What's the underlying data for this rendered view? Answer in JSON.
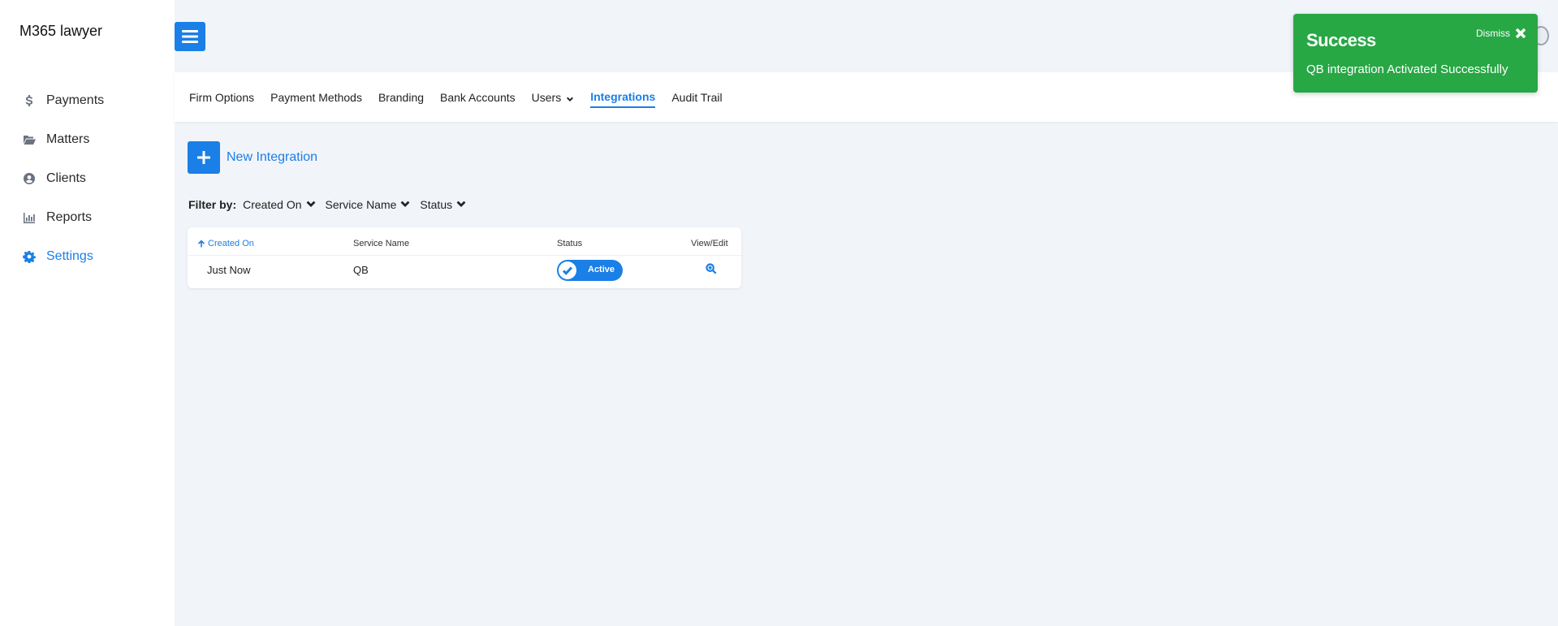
{
  "app": {
    "brand": "M365 lawyer"
  },
  "sidebar": {
    "items": [
      {
        "label": "Payments",
        "icon": "dollar-icon"
      },
      {
        "label": "Matters",
        "icon": "folder-open-icon"
      },
      {
        "label": "Clients",
        "icon": "user-circle-icon"
      },
      {
        "label": "Reports",
        "icon": "bar-chart-icon"
      },
      {
        "label": "Settings",
        "icon": "gear-icon",
        "active": true
      }
    ]
  },
  "tabs": [
    {
      "label": "Firm Options"
    },
    {
      "label": "Payment Methods"
    },
    {
      "label": "Branding"
    },
    {
      "label": "Bank Accounts"
    },
    {
      "label": "Users",
      "dropdown": true
    },
    {
      "label": "Integrations",
      "active": true
    },
    {
      "label": "Audit Trail"
    }
  ],
  "actions": {
    "new_integration": "New Integration"
  },
  "filter": {
    "label": "Filter by:",
    "options": [
      "Created On",
      "Service Name",
      "Status"
    ]
  },
  "table": {
    "headers": [
      "Created On",
      "Service Name",
      "Status",
      "View/Edit"
    ],
    "rows": [
      {
        "created_on": "Just Now",
        "service_name": "QB",
        "status": "Active"
      }
    ]
  },
  "toast": {
    "title": "Success",
    "dismiss": "Dismiss",
    "message": "QB integration Activated Successfully"
  },
  "colors": {
    "accent": "#1a7fe6",
    "success": "#28a745",
    "background": "#f1f4f9"
  }
}
